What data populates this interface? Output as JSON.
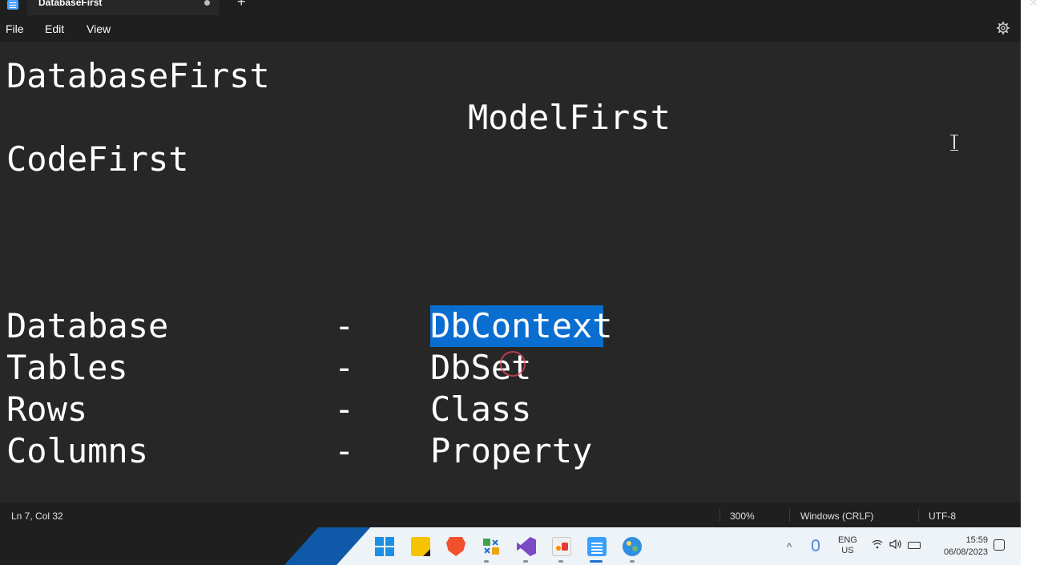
{
  "window": {
    "tab_title": "DatabaseFirst",
    "new_tab_label": "+",
    "close_label": "✕"
  },
  "menu": {
    "file": "File",
    "edit": "Edit",
    "view": "View"
  },
  "editor": {
    "lines": [
      "DatabaseFirst",
      "ModelFirst",
      "CodeFirst"
    ],
    "rows": [
      {
        "left": "Database",
        "sep": "-",
        "right": "DbContext"
      },
      {
        "left": "Tables",
        "sep": "-",
        "right": "DbSet"
      },
      {
        "left": "Rows",
        "sep": "-",
        "right": "Class"
      },
      {
        "left": "Columns",
        "sep": "-",
        "right": "Property"
      }
    ],
    "selected_text": "DbContext"
  },
  "status": {
    "position": "Ln 7, Col 32",
    "zoom": "300%",
    "line_ending": "Windows (CRLF)",
    "encoding": "UTF-8"
  },
  "taskbar": {
    "apps": [
      "start-icon",
      "sticky-notes-icon",
      "brave-icon",
      "tool-icon",
      "visual-studio-icon",
      "paint-icon",
      "notepad-icon",
      "photos-icon"
    ],
    "tray_chevron": "^",
    "lang_top": "ENG",
    "lang_bottom": "US",
    "time": "15:59",
    "date": "06/08/2023"
  },
  "colors": {
    "editor_bg": "#272727",
    "chrome_bg": "#1f1f1f",
    "selection": "#0a6ed1",
    "taskbar_bg": "#eef3f8"
  }
}
